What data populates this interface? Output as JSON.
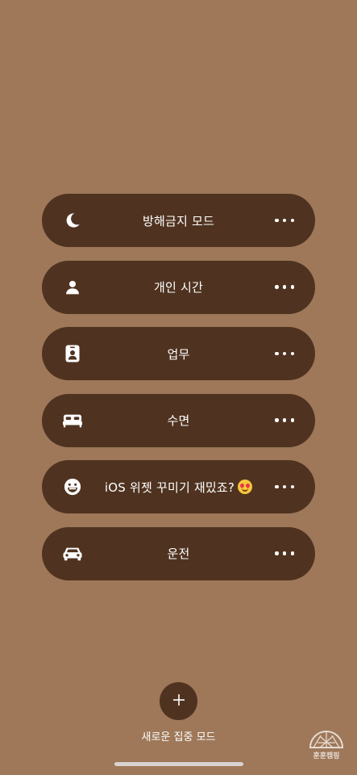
{
  "focus_modes": [
    {
      "label": "방해금지 모드",
      "icon": "moon-icon"
    },
    {
      "label": "개인 시간",
      "icon": "person-icon"
    },
    {
      "label": "업무",
      "icon": "id-badge-icon"
    },
    {
      "label": "수면",
      "icon": "bed-icon"
    },
    {
      "label": "iOS 위젯 꾸미기 재밌죠?",
      "icon": "smiley-icon",
      "emoji": "heart-eyes-emoji"
    },
    {
      "label": "운전",
      "icon": "car-icon"
    }
  ],
  "add_focus": {
    "label": "새로운 집중 모드",
    "icon": "plus-icon"
  },
  "watermark": {
    "text": "훈훈캠핑"
  },
  "colors": {
    "background": "#9e7859",
    "card": "#4f3320",
    "text": "#ffffff"
  }
}
